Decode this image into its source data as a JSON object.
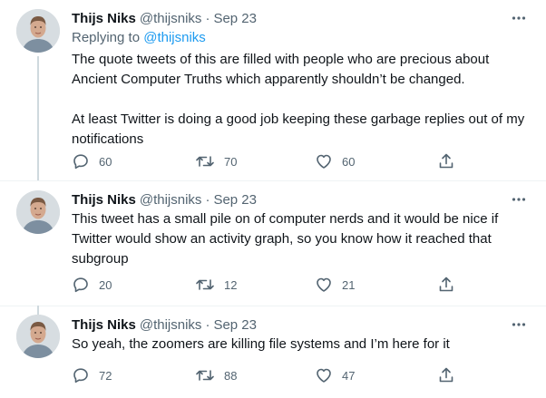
{
  "colors": {
    "text": "#0f1419",
    "secondary": "#536471",
    "link": "#1d9bf0",
    "thread_line": "#cfd9de",
    "divider": "#eff3f4"
  },
  "icons": {
    "reply": "reply-icon",
    "retweet": "retweet-icon",
    "like": "heart-icon",
    "share": "share-icon",
    "more": "more-icon"
  },
  "tweets": [
    {
      "name": "Thijs Niks",
      "handle": "@thijsniks",
      "separator": "·",
      "date": "Sep 23",
      "replying_label": "Replying to",
      "replying_to": "@thijsniks",
      "paragraphs": [
        "The quote tweets of this are filled with people who are precious about\nAncient Computer Truths which apparently shouldn’t be changed.",
        "At least Twitter is doing a good job keeping these garbage replies out of my\nnotifications"
      ],
      "replies": "60",
      "retweets": "70",
      "likes": "60"
    },
    {
      "name": "Thijs Niks",
      "handle": "@thijsniks",
      "separator": "·",
      "date": "Sep 23",
      "paragraphs": [
        "This tweet has a small pile on of computer nerds and it would be nice if\nTwitter would show an activity graph, so you know how it reached that\nsubgroup"
      ],
      "replies": "20",
      "retweets": "12",
      "likes": "21"
    },
    {
      "name": "Thijs Niks",
      "handle": "@thijsniks",
      "separator": "·",
      "date": "Sep 23",
      "paragraphs": [
        "So yeah, the zoomers are killing file systems and I’m here for it"
      ],
      "replies": "72",
      "retweets": "88",
      "likes": "47"
    }
  ]
}
